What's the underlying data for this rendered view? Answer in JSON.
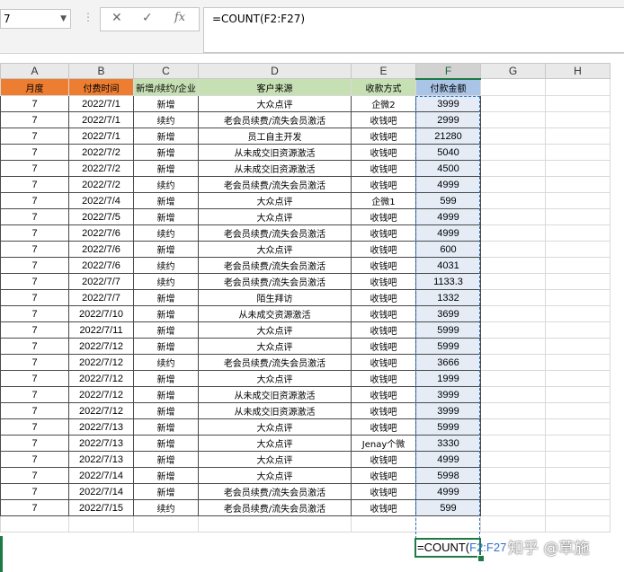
{
  "formula_bar": {
    "name_box": "7",
    "cancel_icon": "✕",
    "enter_icon": "✓",
    "fx_label": "fx",
    "formula": "=COUNT(F2:F27)"
  },
  "columns": [
    "A",
    "B",
    "C",
    "D",
    "E",
    "F",
    "G",
    "H"
  ],
  "selected_column": "F",
  "header_row": [
    "月度",
    "付费时间",
    "新增/续约/企业",
    "客户来源",
    "收款方式",
    "付款金额"
  ],
  "rows": [
    [
      "7",
      "2022/7/1",
      "新增",
      "大众点评",
      "企微2",
      "3999"
    ],
    [
      "7",
      "2022/7/1",
      "续约",
      "老会员续费/流失会员激活",
      "收钱吧",
      "2999"
    ],
    [
      "7",
      "2022/7/1",
      "新增",
      "员工自主开发",
      "收钱吧",
      "21280"
    ],
    [
      "7",
      "2022/7/2",
      "新增",
      "从未成交旧资源激活",
      "收钱吧",
      "5040"
    ],
    [
      "7",
      "2022/7/2",
      "新增",
      "从未成交旧资源激活",
      "收钱吧",
      "4500"
    ],
    [
      "7",
      "2022/7/2",
      "续约",
      "老会员续费/流失会员激活",
      "收钱吧",
      "4999"
    ],
    [
      "7",
      "2022/7/4",
      "新增",
      "大众点评",
      "企微1",
      "599"
    ],
    [
      "7",
      "2022/7/5",
      "新增",
      "大众点评",
      "收钱吧",
      "4999"
    ],
    [
      "7",
      "2022/7/6",
      "续约",
      "老会员续费/流失会员激活",
      "收钱吧",
      "4999"
    ],
    [
      "7",
      "2022/7/6",
      "新增",
      "大众点评",
      "收钱吧",
      "600"
    ],
    [
      "7",
      "2022/7/6",
      "续约",
      "老会员续费/流失会员激活",
      "收钱吧",
      "4031"
    ],
    [
      "7",
      "2022/7/7",
      "续约",
      "老会员续费/流失会员激活",
      "收钱吧",
      "1133.3"
    ],
    [
      "7",
      "2022/7/7",
      "新增",
      "陌生拜访",
      "收钱吧",
      "1332"
    ],
    [
      "7",
      "2022/7/10",
      "新增",
      "从未成交资源激活",
      "收钱吧",
      "3699"
    ],
    [
      "7",
      "2022/7/11",
      "新增",
      "大众点评",
      "收钱吧",
      "5999"
    ],
    [
      "7",
      "2022/7/12",
      "新增",
      "大众点评",
      "收钱吧",
      "5999"
    ],
    [
      "7",
      "2022/7/12",
      "续约",
      "老会员续费/流失会员激活",
      "收钱吧",
      "3666"
    ],
    [
      "7",
      "2022/7/12",
      "新增",
      "大众点评",
      "收钱吧",
      "1999"
    ],
    [
      "7",
      "2022/7/12",
      "新增",
      "从未成交旧资源激活",
      "收钱吧",
      "3999"
    ],
    [
      "7",
      "2022/7/12",
      "新增",
      "从未成交旧资源激活",
      "收钱吧",
      "3999"
    ],
    [
      "7",
      "2022/7/13",
      "新增",
      "大众点评",
      "收钱吧",
      "5999"
    ],
    [
      "7",
      "2022/7/13",
      "新增",
      "大众点评",
      "Jenay个微",
      "3330"
    ],
    [
      "7",
      "2022/7/13",
      "新增",
      "大众点评",
      "收钱吧",
      "4999"
    ],
    [
      "7",
      "2022/7/14",
      "新增",
      "大众点评",
      "收钱吧",
      "5998"
    ],
    [
      "7",
      "2022/7/14",
      "新增",
      "老会员续费/流失会员激活",
      "收钱吧",
      "4999"
    ],
    [
      "7",
      "2022/7/15",
      "续约",
      "老会员续费/流失会员激活",
      "收钱吧",
      "599"
    ]
  ],
  "edit_cell": {
    "prefix": "=COUNT(",
    "ref": "F2:F27"
  },
  "watermark": "知乎 @草施",
  "colors": {
    "header_orange": "#ed7d31",
    "header_green": "#c6e0b4",
    "header_blue": "#a9c4e6",
    "selection_green": "#1d7a45",
    "range_blue": "#2f6fc6"
  }
}
